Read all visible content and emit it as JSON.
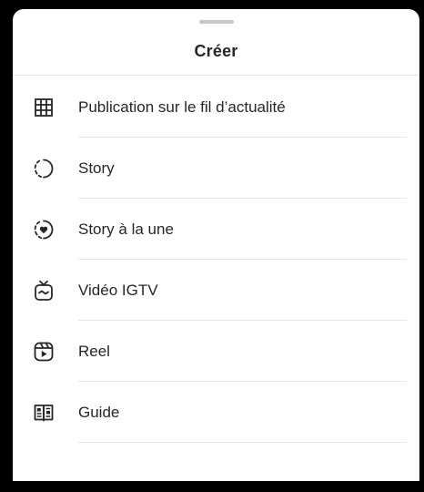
{
  "sheet": {
    "title": "Créer"
  },
  "menu": {
    "items": [
      {
        "label": "Publication sur le fil d’actualité",
        "icon": "grid-icon"
      },
      {
        "label": "Story",
        "icon": "story-circle-icon"
      },
      {
        "label": "Story à la une",
        "icon": "highlight-heart-icon"
      },
      {
        "label": "Vidéo IGTV",
        "icon": "igtv-icon"
      },
      {
        "label": "Reel",
        "icon": "reel-icon"
      },
      {
        "label": "Guide",
        "icon": "guide-book-icon"
      }
    ]
  },
  "colors": {
    "text": "#262626",
    "divider": "#e6e6e6",
    "handle": "#c7c7c7",
    "background": "#ffffff"
  }
}
